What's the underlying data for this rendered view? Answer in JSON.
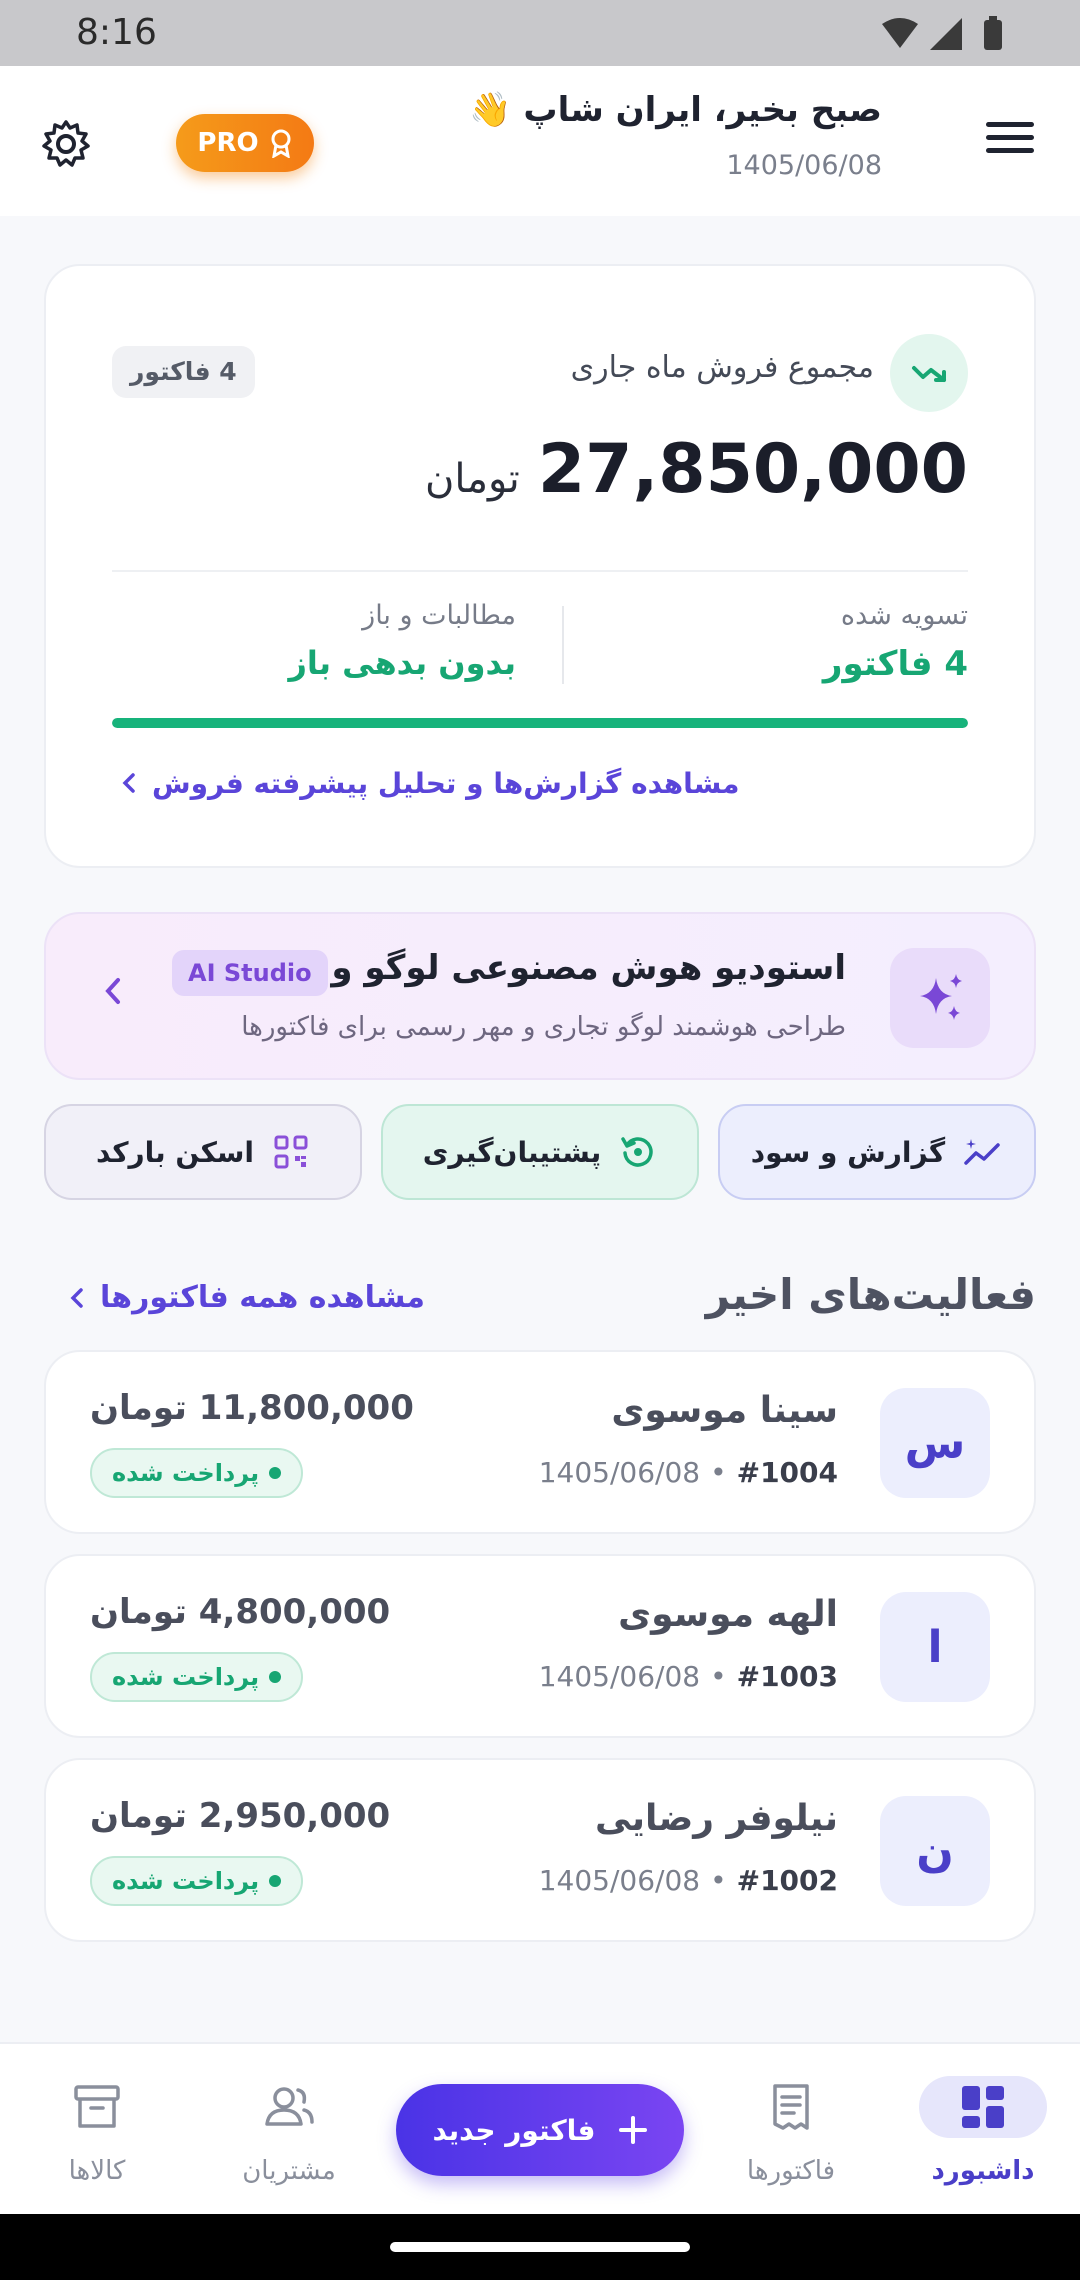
{
  "status_bar": {
    "time": "8:16"
  },
  "header": {
    "greeting": "صبح بخیر، ایران شاپ 👋",
    "date": "1405/06/08",
    "pro_label": "PRO"
  },
  "sales_card": {
    "title": "مجموع فروش ماه جاری",
    "invoice_count": "4 فاکتور",
    "amount": "27,850,000",
    "currency": "تومان",
    "settled_label": "تسویه شده",
    "settled_value": "4 فاکتور",
    "receivables_label": "مطالبات و باز",
    "receivables_value": "بدون بدهی باز",
    "settled_progress_percent": 100,
    "report_link": "مشاهده گزارش‌ها و تحلیل پیشرفته فروش"
  },
  "ai_studio": {
    "title": "استودیو هوش مصنوعی لوگو و مهر",
    "tag": "AI Studio",
    "subtitle": "طراحی هوشمند لوگو تجاری و مهر رسمی برای فاکتورها"
  },
  "quick_actions": [
    {
      "label": "گزارش و سود",
      "icon": "chart-sparkle-icon"
    },
    {
      "label": "پشتیبان‌گیری",
      "icon": "backup-icon"
    },
    {
      "label": "اسکن بارکد",
      "icon": "qr-scan-icon"
    }
  ],
  "recent": {
    "title": "فعالیت‌های اخیر",
    "all_link": "مشاهده همه فاکتورها",
    "invoices": [
      {
        "initial": "س",
        "name": "سینا موسوی",
        "number": "#1004",
        "date": "1405/06/08",
        "amount": "11,800,000 تومان",
        "status": "پرداخت شده"
      },
      {
        "initial": "ا",
        "name": "الهه موسوی",
        "number": "#1003",
        "date": "1405/06/08",
        "amount": "4,800,000 تومان",
        "status": "پرداخت شده"
      },
      {
        "initial": "ن",
        "name": "نیلوفر رضایی",
        "number": "#1002",
        "date": "1405/06/08",
        "amount": "2,950,000 تومان",
        "status": "پرداخت شده"
      }
    ]
  },
  "bottom_nav": {
    "dashboard": "داشبورد",
    "invoices": "فاکتورها",
    "new_invoice": "فاکتور جدید",
    "customers": "مشتریان",
    "products": "کالاها"
  },
  "colors": {
    "accent": "#5a45d9",
    "success": "#17a673",
    "pro": "#f58a1a"
  }
}
